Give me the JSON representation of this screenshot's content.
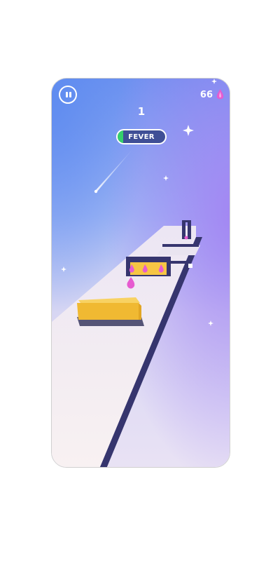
{
  "hud": {
    "level": "1",
    "gem_count": "66",
    "fever_label": "FEVER",
    "fever_progress": 0.12,
    "pause_icon": "pause-icon",
    "gem_icon": "pink-gem-icon"
  },
  "colors": {
    "sky_top": "#7b9cf5",
    "sky_mid": "#c6cdf4",
    "sky_accent": "#a98bf2",
    "track_top": "#f6f0f2",
    "track_side": "#36356e",
    "yellow_block": "#f6c544",
    "gem_pink": "#e65bd0",
    "fever_bg": "#3f4f96",
    "fever_fill": "#34d06b"
  }
}
